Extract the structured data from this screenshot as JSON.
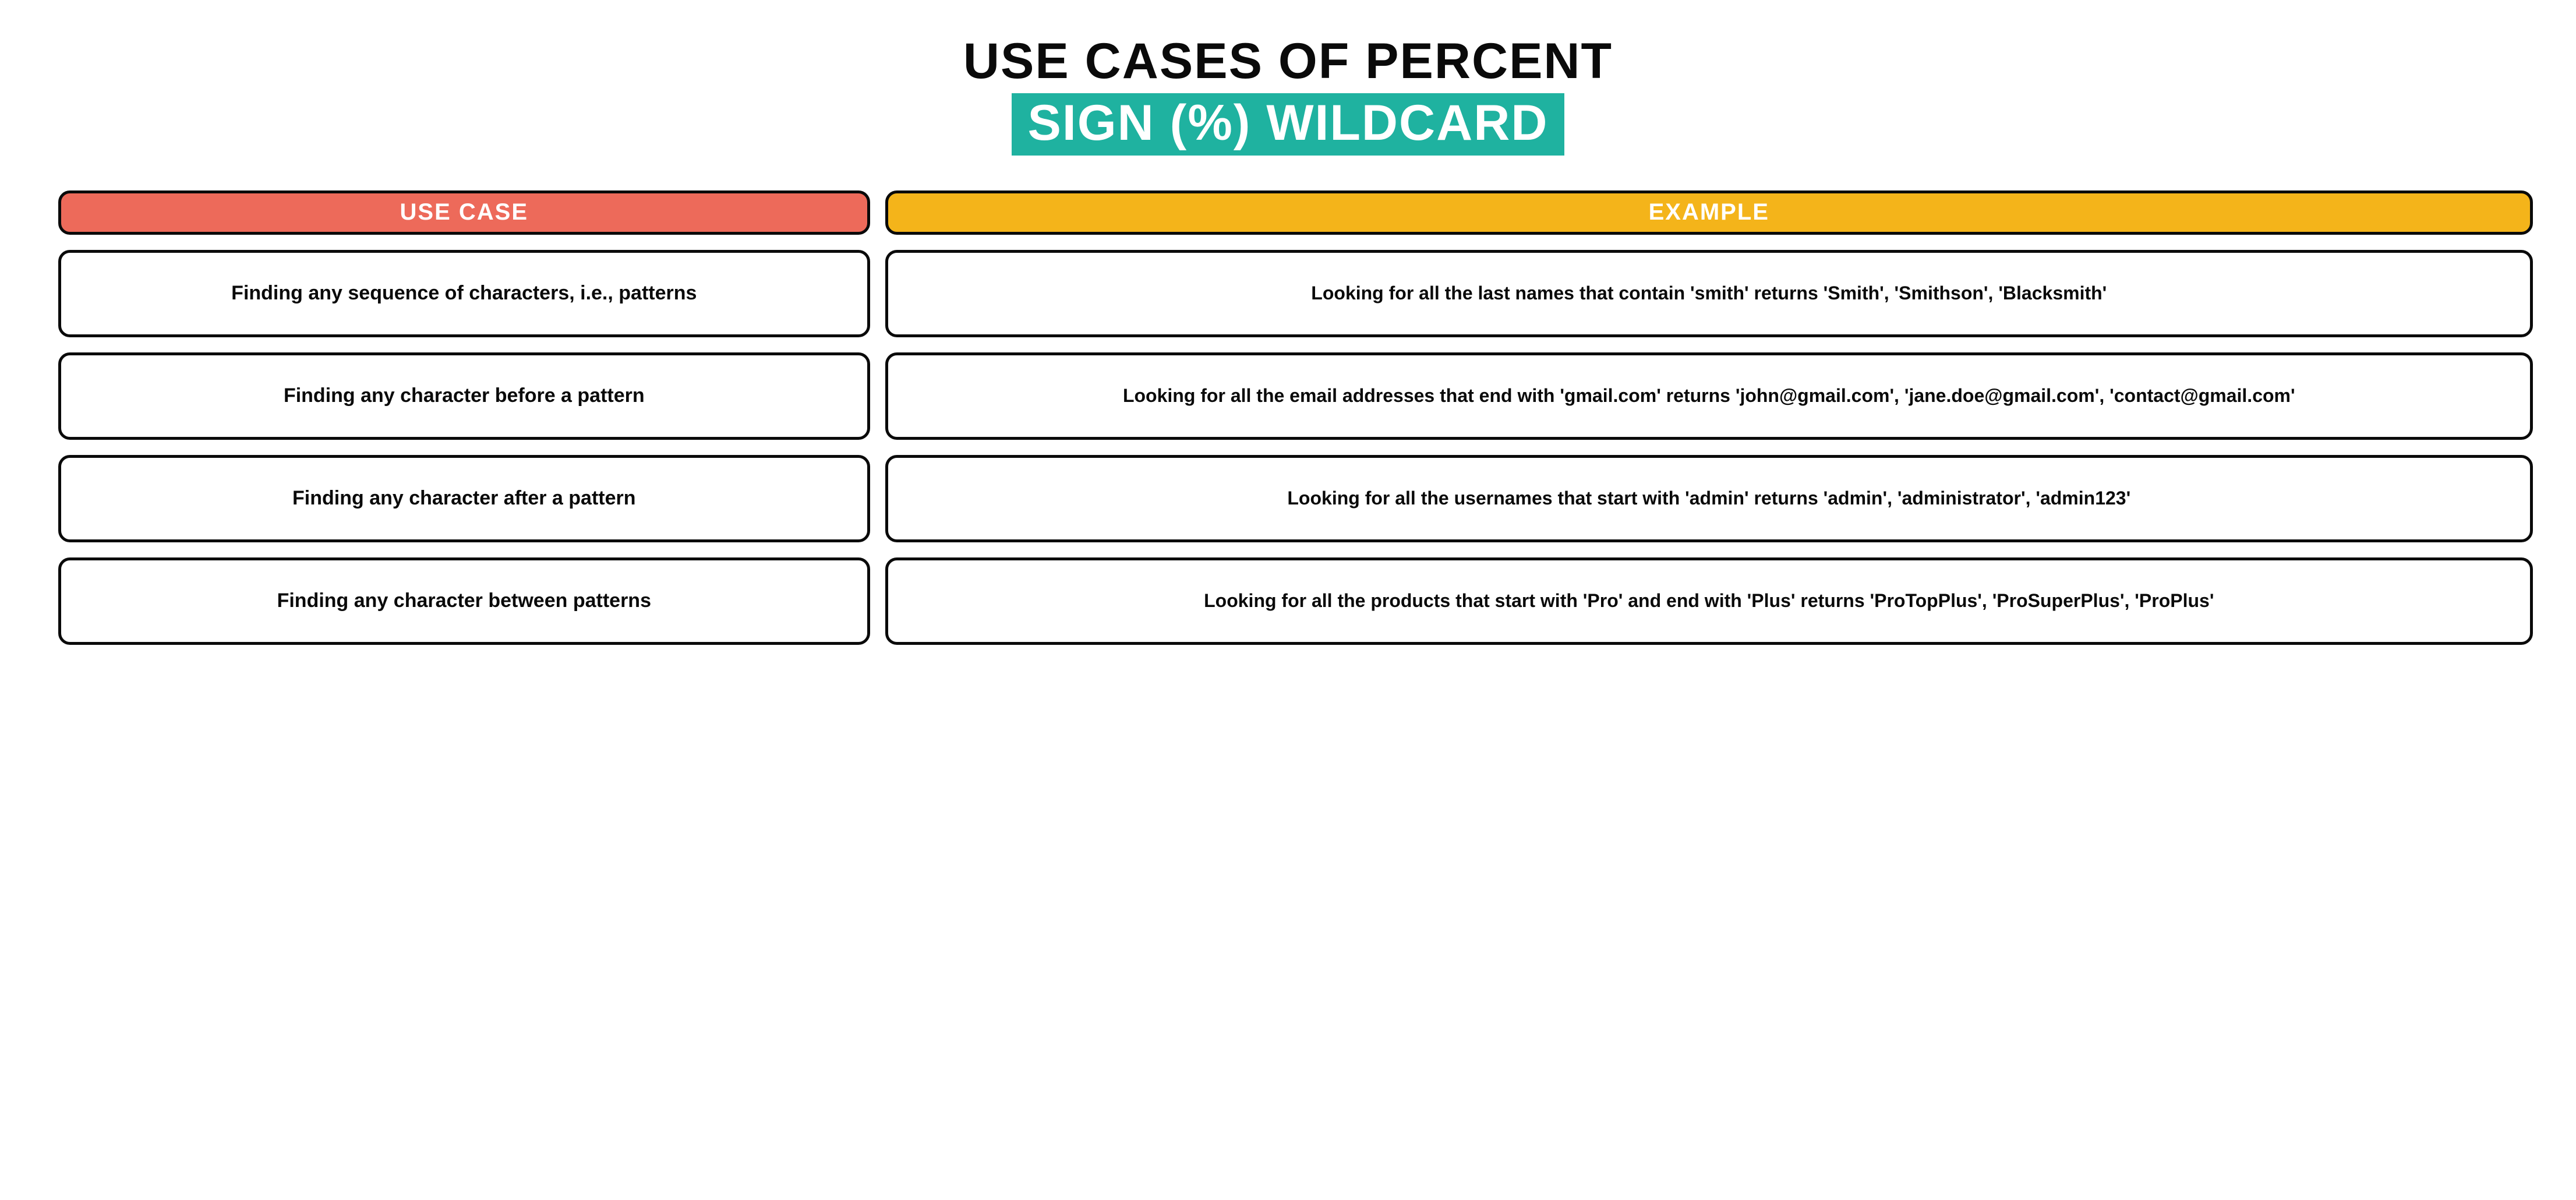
{
  "title": {
    "line1": "USE CASES OF PERCENT",
    "line2": "SIGN (%) WILDCARD"
  },
  "headers": {
    "usecase": "USE CASE",
    "example": "EXAMPLE"
  },
  "rows": [
    {
      "usecase": "Finding any sequence of characters, i.e., patterns",
      "example": "Looking for all the last names that contain 'smith' returns 'Smith', 'Smithson', 'Blacksmith'"
    },
    {
      "usecase": "Finding any character before a pattern",
      "example": "Looking for all the email addresses that end with 'gmail.com' returns 'john@gmail.com', 'jane.doe@gmail.com', 'contact@gmail.com'"
    },
    {
      "usecase": "Finding any character after a pattern",
      "example": "Looking for all the usernames that start with 'admin' returns 'admin', 'administrator', 'admin123'"
    },
    {
      "usecase": "Finding any character between patterns",
      "example": "Looking for all the products that start with 'Pro' and end with 'Plus' returns 'ProTopPlus', 'ProSuperPlus', 'ProPlus'"
    }
  ],
  "colors": {
    "teal": "#1fb2a0",
    "coral": "#ed6a5a",
    "amber": "#f4b41a",
    "ink": "#0a0a0a",
    "paper": "#ffffff"
  }
}
